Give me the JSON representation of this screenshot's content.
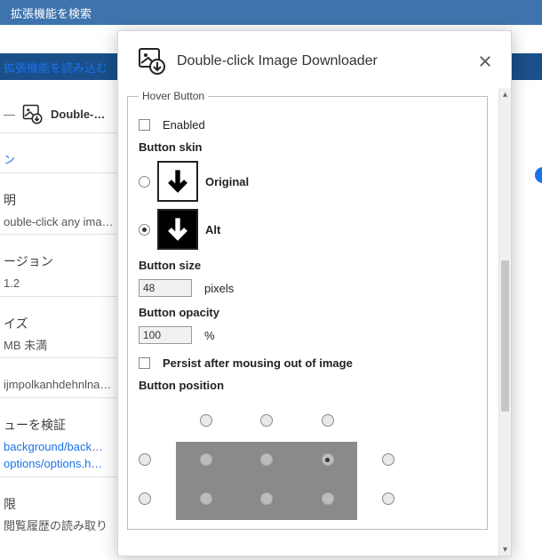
{
  "background": {
    "search_placeholder": "拡張機能を検索",
    "load_link": "拡張機能を読み込む",
    "item_name": "Double-…",
    "toggle_label": "ン",
    "desc_heading": "明",
    "desc_text": "ouble-click any ima…",
    "version_heading": "ージョン",
    "version_value": "1.2",
    "size_heading": "イズ",
    "size_value": "MB 未満",
    "id_value": "ijmpolkanhdehnlna…",
    "views_heading": "ューを検証",
    "view_links": [
      "background/back…",
      "options/options.h…"
    ],
    "perm_heading": "限",
    "perm_item": "閲覧履歴の読み取り"
  },
  "modal": {
    "title": "Double-click Image Downloader",
    "legend": "Hover Button",
    "enabled_label": "Enabled",
    "skin": {
      "label": "Button skin",
      "original": "Original",
      "alt": "Alt",
      "selected": "alt"
    },
    "size": {
      "label": "Button size",
      "value": "48",
      "unit": "pixels"
    },
    "opacity": {
      "label": "Button opacity",
      "value": "100",
      "unit": "%"
    },
    "persist_label": "Persist after mousing out of image",
    "position": {
      "label": "Button position",
      "selected": [
        1,
        3
      ]
    }
  }
}
